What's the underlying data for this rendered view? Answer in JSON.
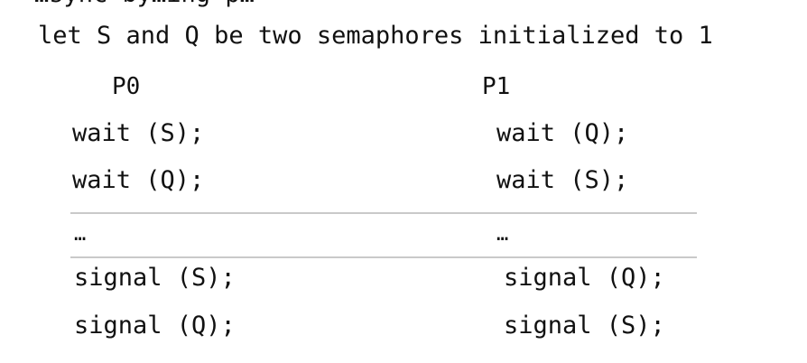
{
  "partial_top_line": "…sync by…ing p…",
  "intro": "let S and Q be two semaphores initialized to 1",
  "processes": {
    "p0": {
      "header": "P0",
      "lines": [
        "wait (S);",
        "wait (Q);",
        "…",
        "signal (S);",
        "signal (Q);"
      ]
    },
    "p1": {
      "header": "P1",
      "lines": [
        "wait (Q);",
        "wait (S);",
        "…",
        "signal (Q);",
        "signal (S);"
      ]
    }
  }
}
